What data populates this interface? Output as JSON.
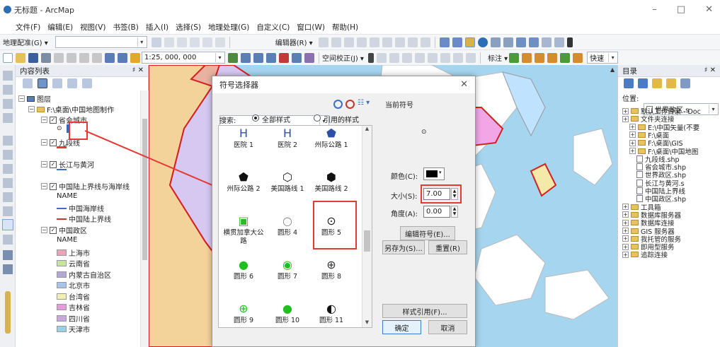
{
  "window": {
    "title": "无标题 - ArcMap",
    "min": "–",
    "max": "□",
    "close": "✕"
  },
  "menu": [
    "文件(F)",
    "编辑(E)",
    "视图(V)",
    "书签(B)",
    "插入(I)",
    "选择(S)",
    "地理处理(G)",
    "自定义(C)",
    "窗口(W)",
    "帮助(H)"
  ],
  "toolbar1": {
    "georef": "地理配准(G) ▾",
    "editor": "编辑器(R) ▾"
  },
  "toolbar2": {
    "scale": "1:25, 000, 000",
    "spatial": "空间校正(J) ▾",
    "label": "标注 ▾",
    "fast": "快速"
  },
  "toc": {
    "title": "内容列表",
    "pin": "♯ ✕",
    "rows": [
      {
        "label": "图层",
        "exp": "⊟"
      },
      {
        "label": "F:\\桌面\\中国地图制作",
        "exp": "⊟"
      },
      {
        "label": "省会城市",
        "exp": "⊟",
        "checked": true
      },
      {
        "label": "九段线",
        "exp": "⊟",
        "checked": true
      },
      {
        "label": "长江与黄河",
        "exp": "⊟",
        "checked": true
      },
      {
        "label": "中国陆上界线与海岸线",
        "exp": "⊟",
        "checked": true
      },
      {
        "label": "NAME"
      },
      {
        "label": "中国海岸线"
      },
      {
        "label": "中国陆上界线"
      },
      {
        "label": "中国政区",
        "exp": "⊟",
        "checked": true
      },
      {
        "label": "NAME"
      },
      {
        "label": "上海市",
        "color": "#e8a6b8"
      },
      {
        "label": "云南省",
        "color": "#c7e59f"
      },
      {
        "label": "内蒙古自治区",
        "color": "#b5a6d8"
      },
      {
        "label": "北京市",
        "color": "#a8c4ea"
      },
      {
        "label": "台湾省",
        "color": "#f3efb4"
      },
      {
        "label": "吉林省",
        "color": "#e79bdd"
      },
      {
        "label": "四川省",
        "color": "#c7a8de"
      },
      {
        "label": "天津市",
        "color": "#9ad0e8"
      }
    ]
  },
  "dialog": {
    "title": "符号选择器",
    "close": "✕",
    "search_label": "搜索:",
    "radio_all": "全部样式",
    "radio_ref": "引用的样式",
    "current_symbol": "当前符号",
    "color_label": "颜色(C):",
    "size_label": "大小(S):",
    "size_value": "7.00",
    "angle_label": "角度(A):",
    "angle_value": "0.00",
    "edit_btn": "编辑符号(E)...",
    "saveas_btn": "另存为(S)...",
    "reset_btn": "重置(R)",
    "style_ref_btn": "样式引用(F)...",
    "ok_btn": "确定",
    "cancel_btn": "取消",
    "symbols": [
      {
        "label": "医院 1",
        "icon": "hospital-1-icon",
        "glyph": "H"
      },
      {
        "label": "医院 2",
        "icon": "hospital-2-icon",
        "glyph": "H"
      },
      {
        "label": "州际公路 1",
        "icon": "interstate-1-icon",
        "glyph": "⬟"
      },
      {
        "label": "州际公路 2",
        "icon": "interstate-2-icon",
        "glyph": "⬟"
      },
      {
        "label": "美国路线 1",
        "icon": "us-route-1-icon",
        "glyph": "⬡"
      },
      {
        "label": "美国路线 2",
        "icon": "us-route-2-icon",
        "glyph": "⬢"
      },
      {
        "label": "横贯加拿大公路",
        "icon": "trans-canada-icon",
        "glyph": "▣"
      },
      {
        "label": "圆形 4",
        "icon": "circle-4-icon",
        "glyph": "○"
      },
      {
        "label": "圆形 5",
        "icon": "circle-5-icon",
        "glyph": "⊙"
      },
      {
        "label": "圆形 6",
        "icon": "circle-6-icon",
        "glyph": "●"
      },
      {
        "label": "圆形 7",
        "icon": "circle-7-icon",
        "glyph": "◉"
      },
      {
        "label": "圆形 8",
        "icon": "circle-8-icon",
        "glyph": "⊕"
      },
      {
        "label": "圆形 9",
        "icon": "circle-9-icon",
        "glyph": "⊕"
      },
      {
        "label": "圆形 10",
        "icon": "circle-10-icon",
        "glyph": "●"
      },
      {
        "label": "圆形 11",
        "icon": "circle-11-icon",
        "glyph": "◐"
      }
    ]
  },
  "catalog": {
    "title": "目录",
    "location_label": "位置:",
    "location_value": "世界政区.s",
    "rows": [
      {
        "label": "默认工作目录 - Doc",
        "type": "folder",
        "indent": 0
      },
      {
        "label": "文件夹连接",
        "type": "folder",
        "indent": 0
      },
      {
        "label": "E:\\中国矢量(不要",
        "type": "folder",
        "indent": 1
      },
      {
        "label": "F:\\桌面",
        "type": "folder",
        "indent": 1
      },
      {
        "label": "F:\\桌面\\GIS",
        "type": "folder",
        "indent": 1
      },
      {
        "label": "F:\\桌面\\中国地图",
        "type": "folder",
        "indent": 1
      },
      {
        "label": "九段线.shp",
        "type": "file",
        "indent": 2
      },
      {
        "label": "省会城市.shp",
        "type": "file",
        "indent": 2
      },
      {
        "label": "世界政区.shp",
        "type": "file",
        "indent": 2
      },
      {
        "label": "长江与黄河.s",
        "type": "file",
        "indent": 2
      },
      {
        "label": "中国陆上界线",
        "type": "file",
        "indent": 2
      },
      {
        "label": "中国政区.shp",
        "type": "file",
        "indent": 2
      },
      {
        "label": "工具箱",
        "type": "folder",
        "indent": 0
      },
      {
        "label": "数据库服务器",
        "type": "folder",
        "indent": 0
      },
      {
        "label": "数据库连接",
        "type": "folder",
        "indent": 0
      },
      {
        "label": "GIS 服务器",
        "type": "folder",
        "indent": 0
      },
      {
        "label": "我托管的服务",
        "type": "folder",
        "indent": 0
      },
      {
        "label": "即用型服务",
        "type": "folder",
        "indent": 0
      },
      {
        "label": "追踪连接",
        "type": "folder",
        "indent": 0
      }
    ]
  },
  "colors": {
    "accent": "#e53935",
    "highlight": "#cfe5ff"
  }
}
